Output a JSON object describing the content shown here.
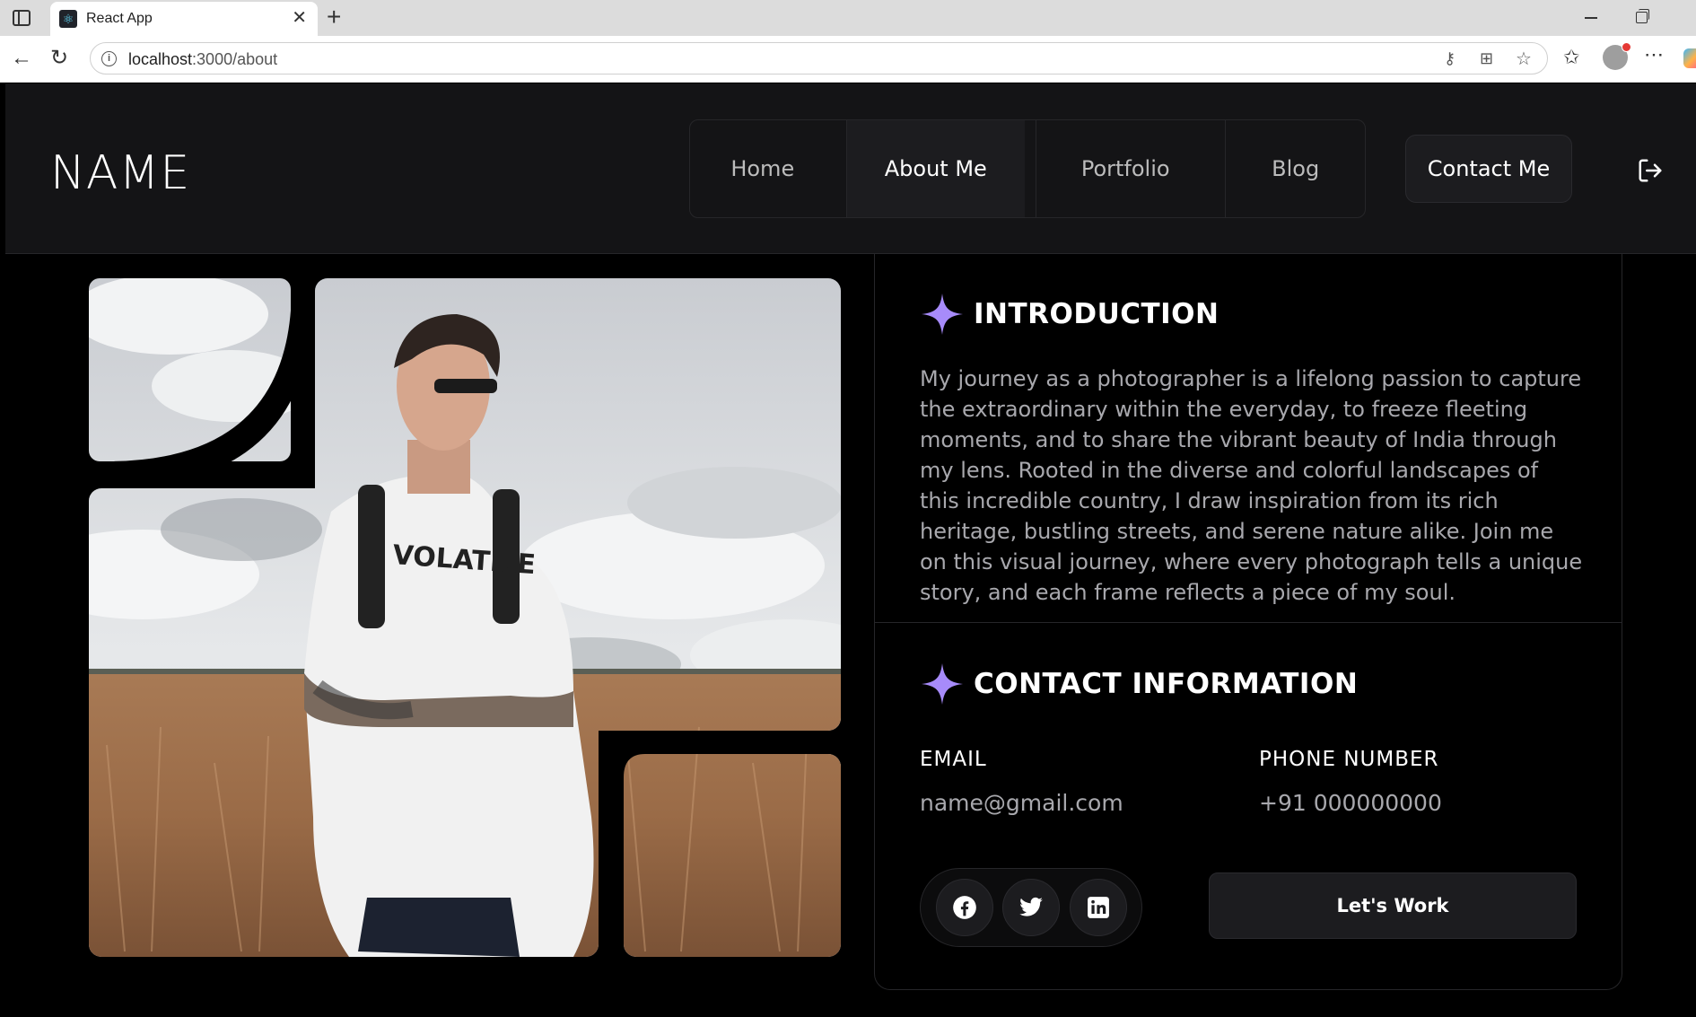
{
  "browser": {
    "tab_title": "React App",
    "url_host": "localhost",
    "url_path": ":3000/about"
  },
  "header": {
    "brand": "NAME",
    "nav": [
      {
        "label": "Home",
        "active": false
      },
      {
        "label": "About Me",
        "active": true
      },
      {
        "label": "Portfolio",
        "active": false
      },
      {
        "label": "Blog",
        "active": false
      }
    ],
    "contact_label": "Contact Me"
  },
  "introduction": {
    "title": "INTRODUCTION",
    "text": "My journey as a photographer is a lifelong passion to capture the extraordinary within the everyday, to freeze fleeting moments, and to share the vibrant beauty of India through my lens. Rooted in the diverse and colorful landscapes of this incredible country, I draw inspiration from its rich heritage, bustling streets, and serene nature alike. Join me on this visual journey, where every photograph tells a unique story, and each frame reflects a piece of my soul."
  },
  "contact": {
    "title": "CONTACT INFORMATION",
    "email_label": "EMAIL",
    "email_value": "name@gmail.com",
    "phone_label": "PHONE NUMBER",
    "phone_value": "+91 000000000",
    "socials": [
      "facebook-icon",
      "twitter-icon",
      "linkedin-icon"
    ],
    "cta_label": "Let's Work"
  },
  "colors": {
    "accent": "#a78bfa",
    "background": "#000000",
    "surface": "#141416"
  }
}
